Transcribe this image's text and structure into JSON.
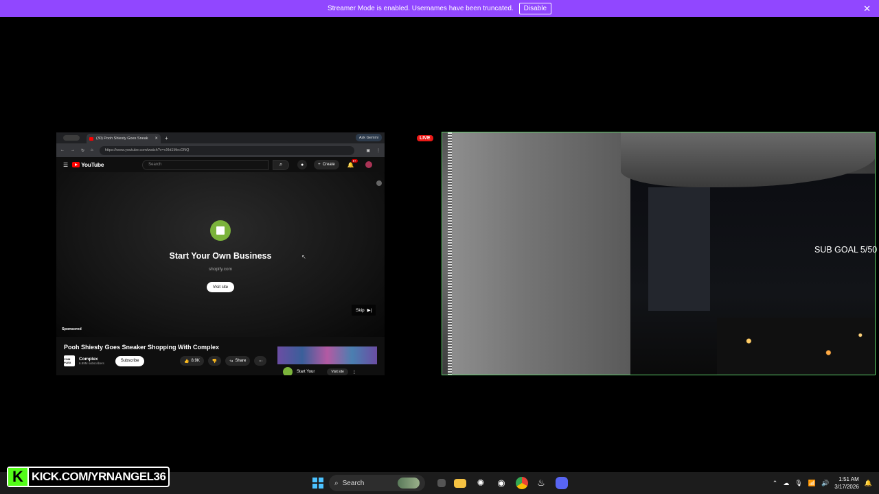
{
  "banner": {
    "message": "Streamer Mode is enabled. Usernames have been truncated.",
    "disable_label": "Disable",
    "close": "✕"
  },
  "browser": {
    "tab_title": "(30) Pooh Shiesty Goes Sneak",
    "tab_close": "✕",
    "new_tab": "+",
    "gemini": "Ask Gemini",
    "url": "https://www.youtube.com/watch?v=vXkt1MecONQ"
  },
  "youtube": {
    "logo": "YouTube",
    "search_placeholder": "Search",
    "create": "Create",
    "notif_count": "9+"
  },
  "ad": {
    "title": "Start Your Own Business",
    "domain": "shopify.com",
    "visit": "Visit site",
    "skip": "Skip",
    "sponsored": "Sponsored"
  },
  "video": {
    "title": "Pooh Shiesty Goes Sneaker Shopping With Complex",
    "channel": "Complex",
    "channel_logo": "COM PLEX",
    "subscribers": "6.89M subscribers",
    "subscribe": "Subscribe",
    "likes": "8.9K",
    "share": "Share",
    "side_title": "Start Your",
    "side_visit": "Visit site"
  },
  "stream": {
    "live": "LIVE",
    "sub_goal": "SUB GOAL 5/50"
  },
  "kick": {
    "logo": "K",
    "url": "KICK.COM/YRNANGEL36"
  },
  "taskbar": {
    "search": "Search",
    "time": "1:51 AM",
    "date": "3/17/2026"
  },
  "colors": {
    "banner": "#9147ff",
    "kick_green": "#53fc18",
    "live_red": "#e91916",
    "cam_border": "#5fd16b"
  }
}
